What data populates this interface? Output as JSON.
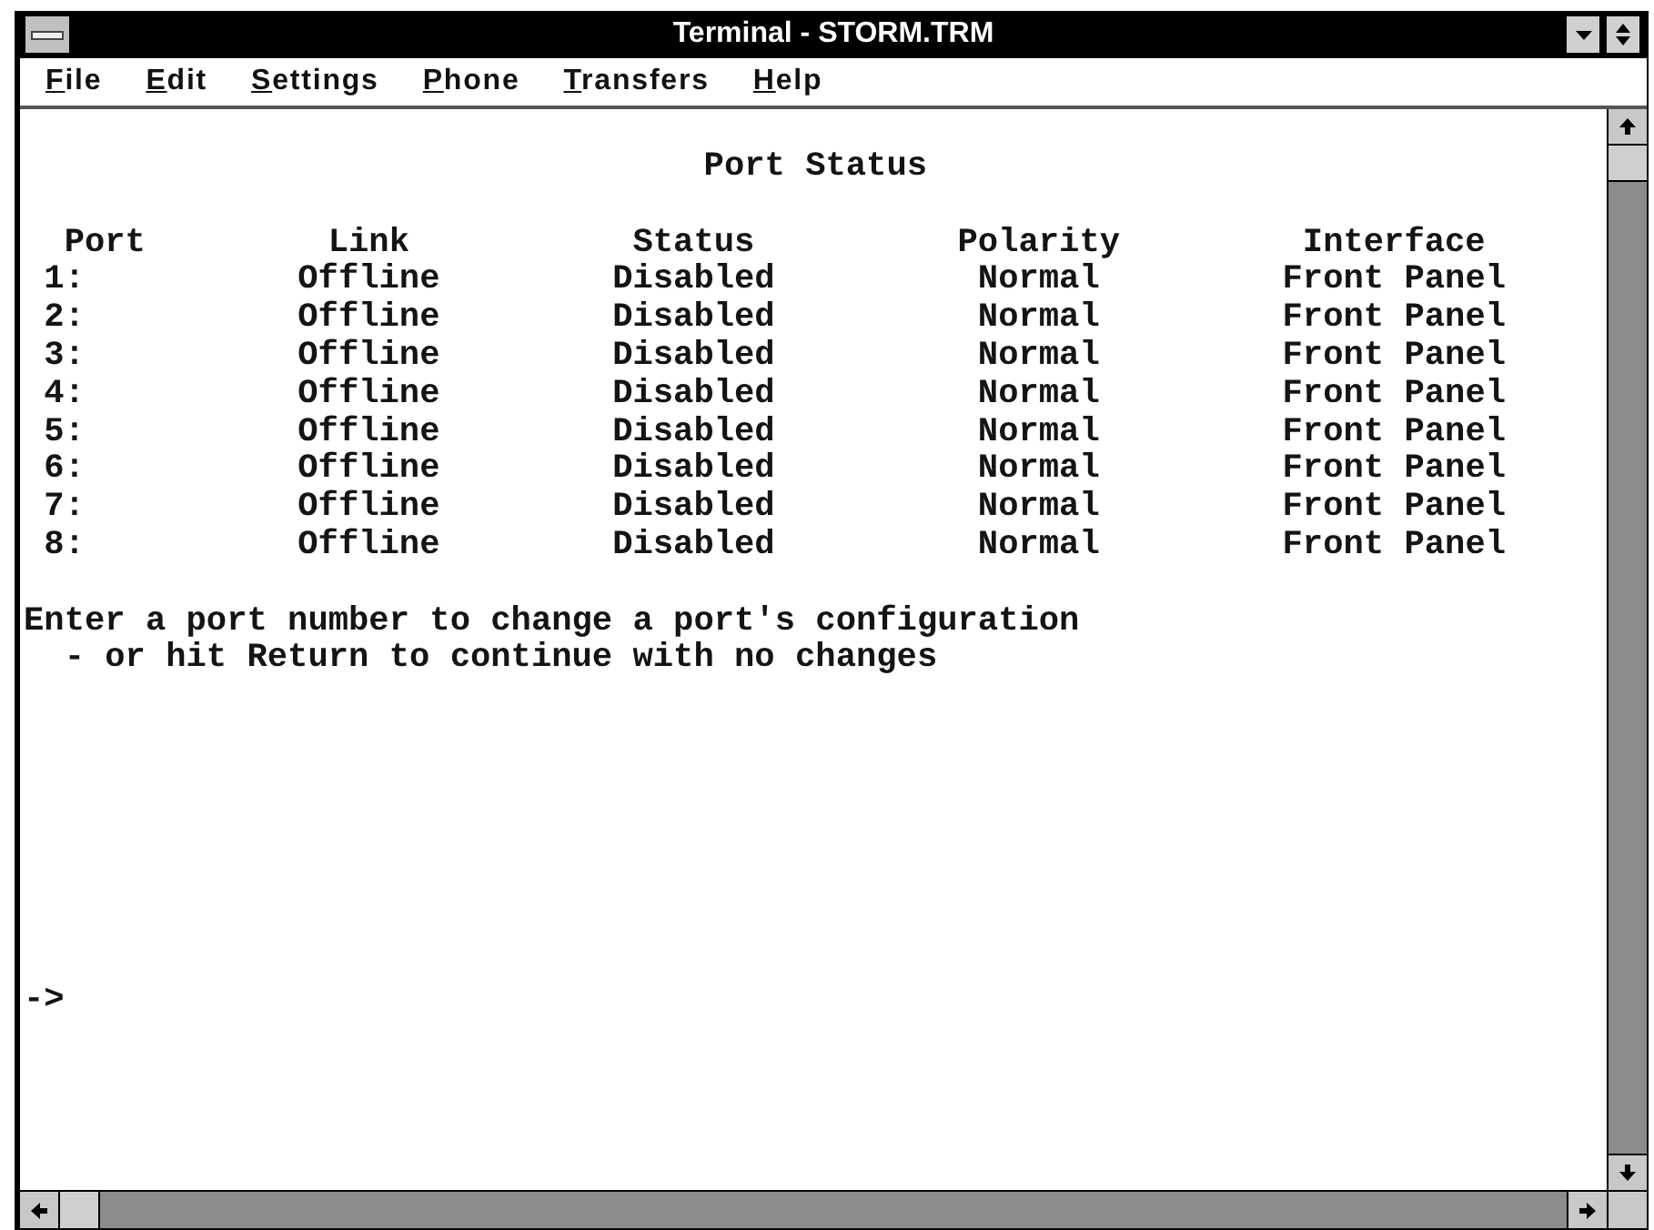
{
  "window": {
    "title": "Terminal - STORM.TRM"
  },
  "menu_bar": {
    "items": [
      "File",
      "Edit",
      "Settings",
      "Phone",
      "Transfers",
      "Help"
    ]
  },
  "terminal": {
    "heading": "Port Status",
    "table": {
      "columns": [
        "Port",
        "Link",
        "Status",
        "Polarity",
        "Interface"
      ],
      "rows": [
        [
          "1:",
          "Offline",
          "Disabled",
          "Normal",
          "Front Panel"
        ],
        [
          "2:",
          "Offline",
          "Disabled",
          "Normal",
          "Front Panel"
        ],
        [
          "3:",
          "Offline",
          "Disabled",
          "Normal",
          "Front Panel"
        ],
        [
          "4:",
          "Offline",
          "Disabled",
          "Normal",
          "Front Panel"
        ],
        [
          "5:",
          "Offline",
          "Disabled",
          "Normal",
          "Front Panel"
        ],
        [
          "6:",
          "Offline",
          "Disabled",
          "Normal",
          "Front Panel"
        ],
        [
          "7:",
          "Offline",
          "Disabled",
          "Normal",
          "Front Panel"
        ],
        [
          "8:",
          "Offline",
          "Disabled",
          "Normal",
          "Front Panel"
        ]
      ]
    },
    "message": [
      {
        "kind": "line",
        "text": "Enter a port number to change a port's configuration"
      },
      {
        "kind": "continuation",
        "text": "- or hit Return to continue with no changes"
      }
    ],
    "prompt": "->"
  }
}
